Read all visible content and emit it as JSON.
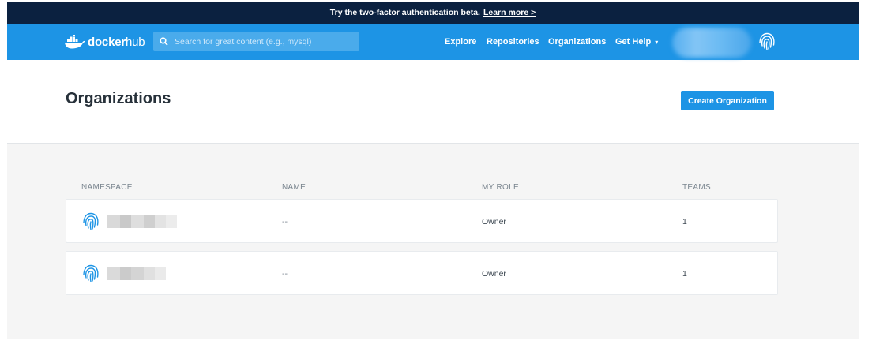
{
  "beta_banner": {
    "text": "Try the two-factor authentication beta.",
    "link": "Learn more >"
  },
  "navbar": {
    "logo_word_1": "docker",
    "logo_word_2": "hub",
    "search_placeholder": "Search for great content (e.g., mysql)",
    "links": [
      "Explore",
      "Repositories",
      "Organizations",
      "Get Help"
    ],
    "help_caret": "▾"
  },
  "page": {
    "title": "Organizations",
    "create_button": "Create Organization"
  },
  "table": {
    "headers": [
      "NAMESPACE",
      "NAME",
      "MY ROLE",
      "TEAMS"
    ],
    "rows": [
      {
        "name": "--",
        "role": "Owner",
        "teams": "1"
      },
      {
        "name": "--",
        "role": "Owner",
        "teams": "1"
      }
    ]
  },
  "colors": {
    "banner_bg": "#0b2140",
    "brand_blue": "#1d94e5",
    "content_bg": "#f5f5f5"
  },
  "icons": [
    "search-icon",
    "docker-whale-logo-icon",
    "fingerprint-avatar-icon",
    "chevron-down-icon"
  ]
}
